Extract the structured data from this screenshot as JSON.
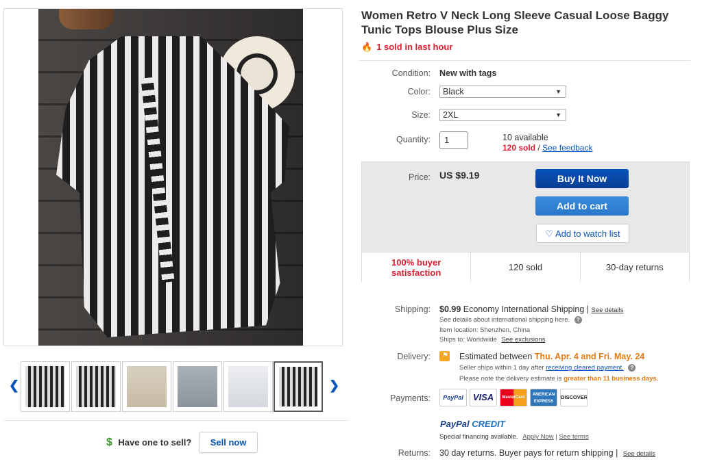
{
  "product": {
    "title": "Women Retro V Neck Long Sleeve Casual Loose Baggy Tunic Tops Blouse Plus Size",
    "sold_last_hour": "1 sold in last hour"
  },
  "details": {
    "condition_label": "Condition:",
    "condition_value": "New with tags",
    "color_label": "Color:",
    "color_value": "Black",
    "size_label": "Size:",
    "size_value": "2XL",
    "quantity_label": "Quantity:",
    "quantity_value": "1",
    "available": "10 available",
    "sold_count": "120 sold",
    "separator": "/",
    "see_feedback": "See feedback"
  },
  "buy_box": {
    "price_label": "Price:",
    "price": "US $9.19",
    "buy_now": "Buy It Now",
    "add_to_cart": "Add to cart",
    "watch_list": "Add to watch list",
    "satisfaction": "100% buyer satisfaction",
    "sold": "120 sold",
    "returns": "30-day returns"
  },
  "shipping": {
    "label": "Shipping:",
    "cost": "$0.99",
    "method": "Economy International Shipping",
    "sep": "|",
    "see_details": "See details",
    "intl_note": "See details about international shipping here.",
    "location_label": "Item location:",
    "location": "Shenzhen, China",
    "ships_to_label": "Ships to:",
    "ships_to": "Worldwide",
    "see_exclusions": "See exclusions"
  },
  "delivery": {
    "label": "Delivery:",
    "estimated": "Estimated between",
    "date_range": "Thu. Apr. 4 and Fri. May. 24",
    "ships_within": "Seller ships within 1 day after",
    "cleared_payment": "receiving cleared payment.",
    "note_prefix": "Please note the delivery estimate is",
    "note_highlight": "greater than 11 business days."
  },
  "payments": {
    "label": "Payments:",
    "logos": [
      "PayPal",
      "VISA",
      "MasterCard",
      "AMERICAN EXPRESS",
      "DISCOVER"
    ],
    "paypal_credit_a": "PayPal",
    "paypal_credit_b": "CREDIT",
    "special_financing": "Special financing available.",
    "apply_now": "Apply Now",
    "sep": "|",
    "see_terms": "See terms"
  },
  "returns": {
    "label": "Returns:",
    "text": "30 day returns. Buyer pays for return shipping",
    "sep": "|",
    "see_details": "See details"
  },
  "sell": {
    "dollar": "$",
    "prompt": "Have one to sell?",
    "button": "Sell now"
  },
  "gallery": {
    "prev": "❮",
    "next": "❯",
    "thumbnails": [
      "dark-stripe",
      "dark-stripe",
      "beige",
      "grey",
      "white",
      "dark-stripe"
    ],
    "selected_index": 5
  },
  "colors": {
    "link": "#0654ba",
    "alert_red": "#dd1e31",
    "buy_blue": "#0654ba",
    "cart_blue": "#3a8dde",
    "orange": "#e47911"
  }
}
